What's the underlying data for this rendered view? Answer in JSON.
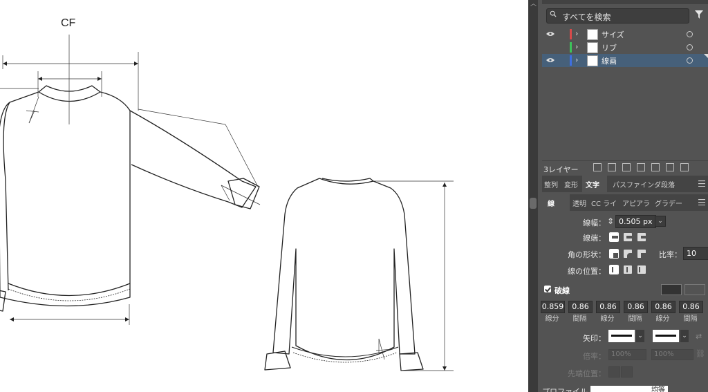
{
  "canvas": {
    "cf_label": "CF"
  },
  "layers_panel": {
    "search_placeholder": "すべてを検索",
    "layers": [
      {
        "name": "サイズ",
        "color": "#d84a4a",
        "visible": true,
        "selected": false
      },
      {
        "name": "リブ",
        "color": "#3cc45a",
        "visible": false,
        "selected": false
      },
      {
        "name": "線画",
        "color": "#3f6fe0",
        "visible": true,
        "selected": true
      }
    ],
    "layer_count": "3レイヤー"
  },
  "panel_tabs_row1": [
    "整列",
    "変形",
    "文字",
    "パスファインダ",
    "段落"
  ],
  "panel_tabs_row2": [
    "線",
    "透明",
    "CC ライ",
    "アピアラ",
    "グラデー"
  ],
  "stroke_panel": {
    "weight_label": "線幅：",
    "weight_value": "0.505 px",
    "cap_label": "線端：",
    "corner_label": "角の形状：",
    "ratio_label": "比率：",
    "ratio_value": "10",
    "align_label": "線の位置：",
    "dashed_label": "破線",
    "dashed_checked": true,
    "dash_values": [
      "0.859",
      "0.86",
      "0.86",
      "0.86",
      "0.86",
      "0.86"
    ],
    "dash_captions": [
      "線分",
      "間隔",
      "線分",
      "間隔",
      "線分",
      "間隔"
    ],
    "arrow_label": "矢印：",
    "scale_label": "倍率：",
    "scale_values": [
      "100%",
      "100%"
    ],
    "align_tip_label": "先端位置：",
    "profile_label": "プロファイル",
    "profile_value": "均等"
  }
}
